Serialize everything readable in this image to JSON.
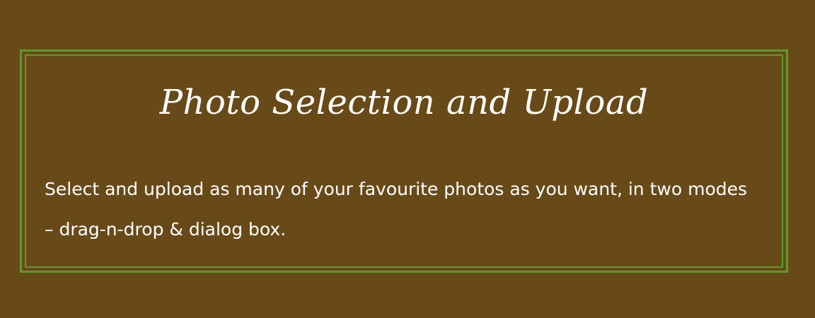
{
  "feature_card": {
    "title": "Photo Selection and Upload",
    "description": "Select and upload as many of your favourite photos as you want, in two modes – drag-n-drop & dialog box."
  },
  "colors": {
    "background": "#684a18",
    "border": "#5e9a2c",
    "text": "#ffffff"
  }
}
